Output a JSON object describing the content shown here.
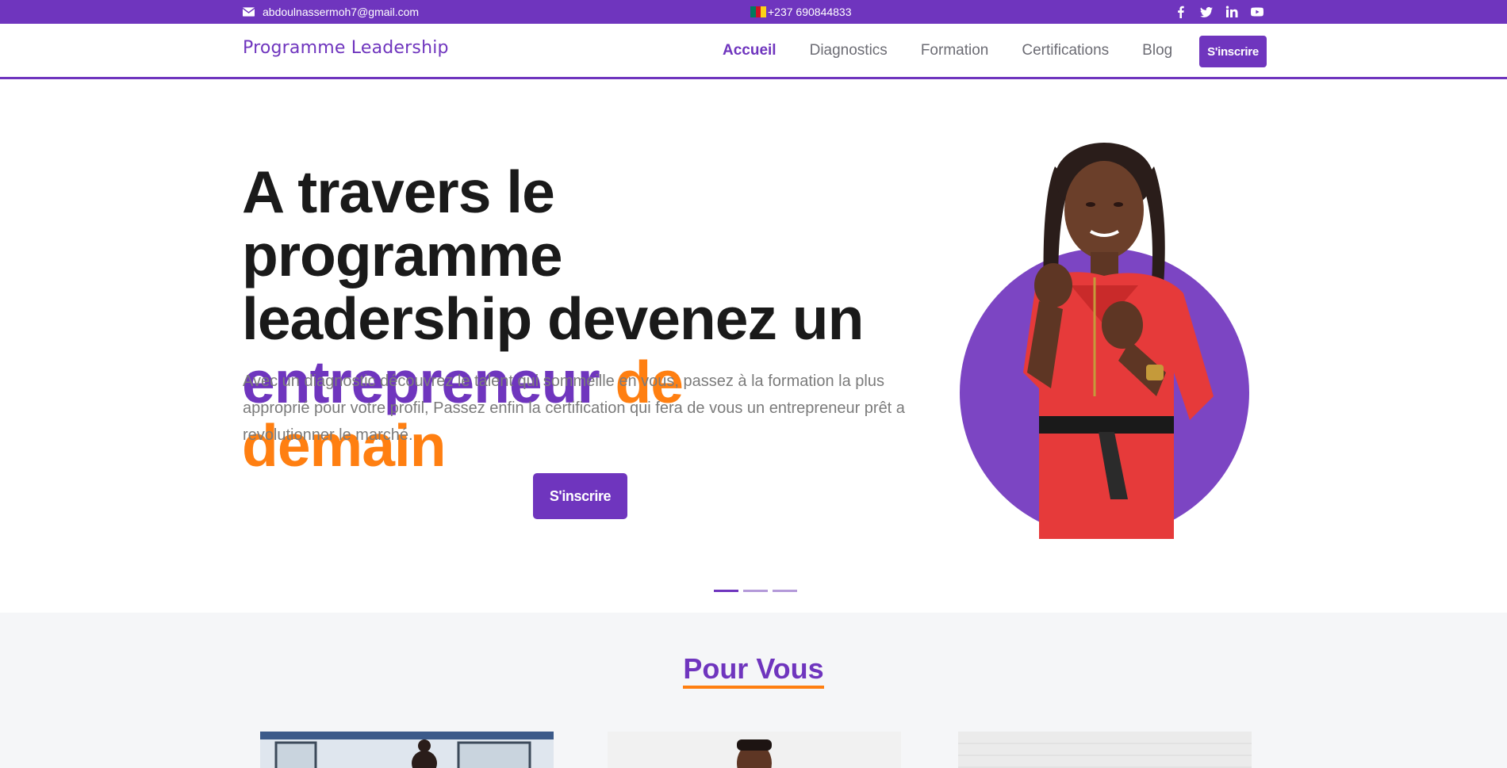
{
  "topbar": {
    "email": "abdoulnassermoh7@gmail.com",
    "phone": "+237 690844833",
    "socials": [
      "facebook-icon",
      "twitter-icon",
      "linkedin-icon",
      "youtube-icon"
    ]
  },
  "header": {
    "logo": "Programme Leadership",
    "nav": [
      "Accueil",
      "Diagnostics",
      "Formation",
      "Certifications",
      "Blog"
    ],
    "active_nav": "Accueil",
    "cta": "S'inscrire"
  },
  "hero": {
    "title_line1": "A travers le programme",
    "title_line2": "leadership devenez un",
    "title_highlight_purple": "entrepreneur",
    "title_highlight_orange": "de demain",
    "description": "Avec un diagnostic découvrez le talent qui sommeille en vous, passez à la formation la plus approprié pour votre profil, Passez enfin la certification qui fera de vous un entrepreneur prêt a revolutionner le marché.",
    "cta": "S'inscrire",
    "slides": 3,
    "active_slide": 1
  },
  "section": {
    "title": "Pour Vous"
  },
  "colors": {
    "primary": "#6f35be",
    "accent": "#ff7f11",
    "text": "#1a1a1a",
    "muted": "#7b7b7b"
  }
}
